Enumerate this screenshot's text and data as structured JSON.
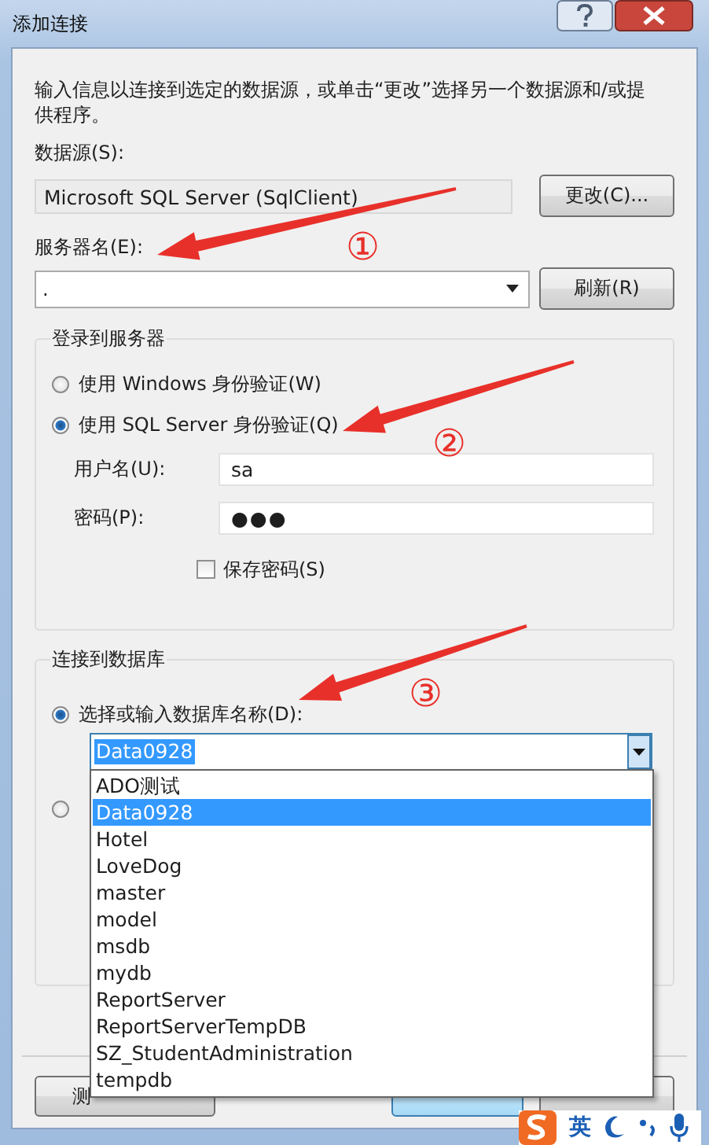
{
  "window": {
    "title": "添加连接"
  },
  "intro": "输入信息以连接到选定的数据源，或单击“更改”选择另一个数据源和/或提供程序。",
  "data_source": {
    "label": "数据源(S):",
    "value": "Microsoft SQL Server (SqlClient)",
    "button": "更改(C)..."
  },
  "server": {
    "label": "服务器名(E):",
    "value": ".",
    "button": "刷新(R)"
  },
  "login_group": {
    "title": "登录到服务器",
    "options": [
      {
        "label": "使用 Windows 身份验证(W)",
        "selected": false
      },
      {
        "label": "使用 SQL Server 身份验证(Q)",
        "selected": true
      }
    ],
    "username": {
      "label": "用户名(U):",
      "value": "sa"
    },
    "password": {
      "label": "密码(P):",
      "value": "●●●"
    },
    "save_password": {
      "label": "保存密码(S)",
      "checked": false
    }
  },
  "database_group": {
    "title": "连接到数据库",
    "options": [
      {
        "label": "选择或输入数据库名称(D):",
        "selected": true
      },
      {
        "selected": false
      }
    ],
    "database": {
      "value": "Data0928"
    },
    "dropdown_items": [
      {
        "label": "ADO测试",
        "selected": false
      },
      {
        "label": "Data0928",
        "selected": true
      },
      {
        "label": "Hotel",
        "selected": false
      },
      {
        "label": "LoveDog",
        "selected": false
      },
      {
        "label": "master",
        "selected": false
      },
      {
        "label": "model",
        "selected": false
      },
      {
        "label": "msdb",
        "selected": false
      },
      {
        "label": "mydb",
        "selected": false
      },
      {
        "label": "ReportServer",
        "selected": false
      },
      {
        "label": "ReportServerTempDB",
        "selected": false
      },
      {
        "label": "SZ_StudentAdministration",
        "selected": false
      },
      {
        "label": "tempdb",
        "selected": false
      }
    ]
  },
  "footer_buttons": [
    {
      "kind": "default",
      "label": "测"
    },
    {
      "kind": "primary"
    },
    {
      "kind": "default"
    }
  ],
  "annotations": [
    {
      "number": "①"
    },
    {
      "number": "②"
    },
    {
      "number": "③"
    }
  ],
  "ime_toolbar": {
    "language": "英"
  }
}
